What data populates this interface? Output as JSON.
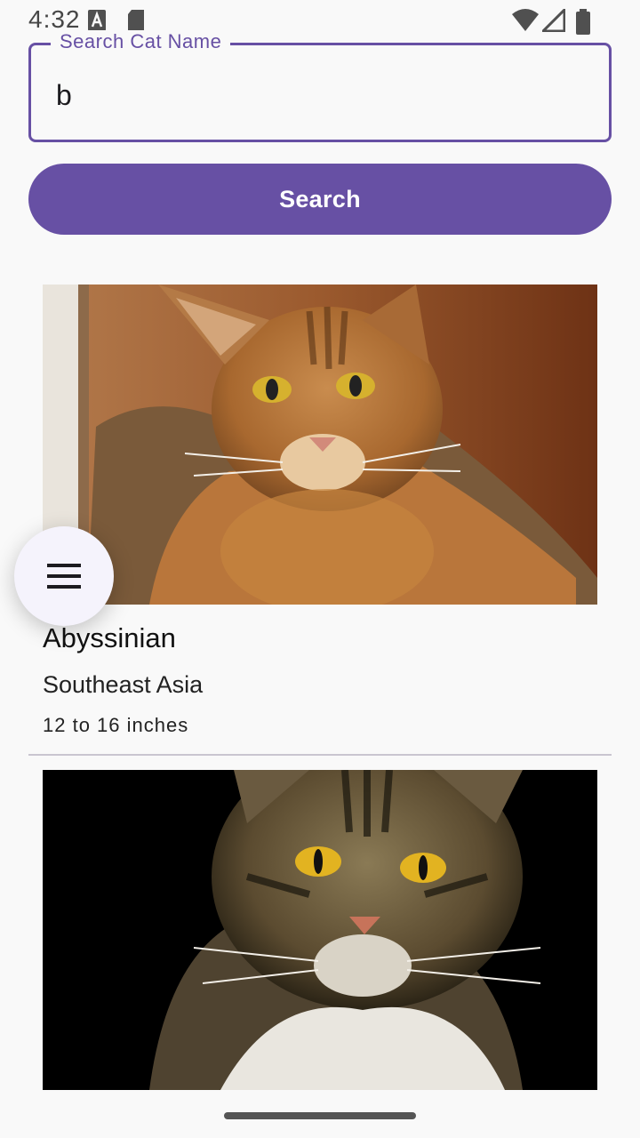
{
  "status_bar": {
    "time": "4:32",
    "icons": [
      "notification-a-icon",
      "sd-card-icon",
      "wifi-icon",
      "signal-icon",
      "battery-icon"
    ]
  },
  "search": {
    "label": "Search Cat Name",
    "value": "b",
    "button_label": "Search"
  },
  "colors": {
    "accent": "#6750a4",
    "background": "#f9f9f9",
    "fab": "#f5f3fc"
  },
  "cats": [
    {
      "name": "Abyssinian",
      "origin": "Southeast Asia",
      "length": "12 to 16 inches",
      "image": "abyssinian-cat-photo"
    },
    {
      "image": "tabby-cat-photo"
    }
  ],
  "menu_button": {
    "icon": "hamburger-menu-icon"
  }
}
